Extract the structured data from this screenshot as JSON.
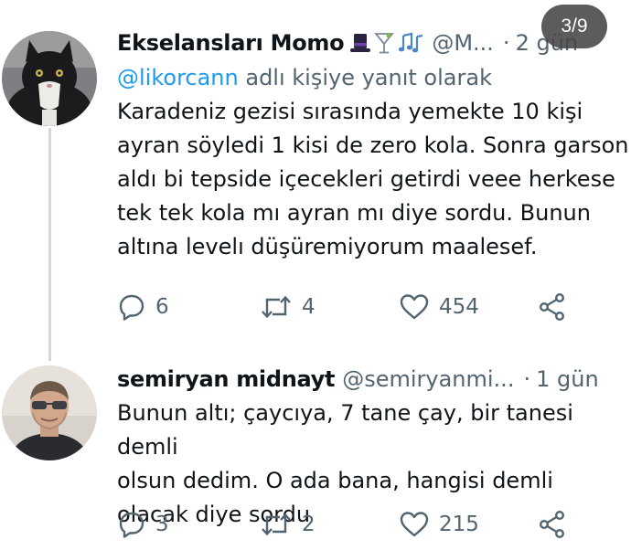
{
  "pager": {
    "label": "3/9"
  },
  "tweets": [
    {
      "name": "Ekselansları Momo",
      "emoji_icons": [
        "top-hat-icon",
        "cocktail-icon",
        "music-notes-icon"
      ],
      "handle": "@M...",
      "separator": "·",
      "time": "2 gün",
      "reply_to_prefix": "@likorcann",
      "reply_to_suffix": " adlı kişiye yanıt olarak",
      "text": "Karadeniz gezisi sırasında yemekte 10 kişi\nayran söyledi 1 kisi de zero kola. Sonra garson\naldı bi tepside içecekleri getirdi veee herkese\ntek tek kola mı ayran mı diye sordu. Bunun\naltına levelı düşüremiyorum maalesef.",
      "replies": "6",
      "retweets": "4",
      "likes": "454"
    },
    {
      "name": "semiryan midnayt",
      "handle": "@semiryanmi...",
      "separator": "·",
      "time": "1 gün",
      "text": "Bunun altı; çaycıya, 7 tane çay, bir tanesi demli\nolsun dedim. O ada bana, hangisi demli\nolacak diye sordu",
      "replies": "3",
      "retweets": "2",
      "likes": "215"
    }
  ],
  "colors": {
    "text": "#0f1419",
    "secondary": "#536471",
    "link": "#1d9bf0",
    "thread_line": "#cfd9de"
  }
}
